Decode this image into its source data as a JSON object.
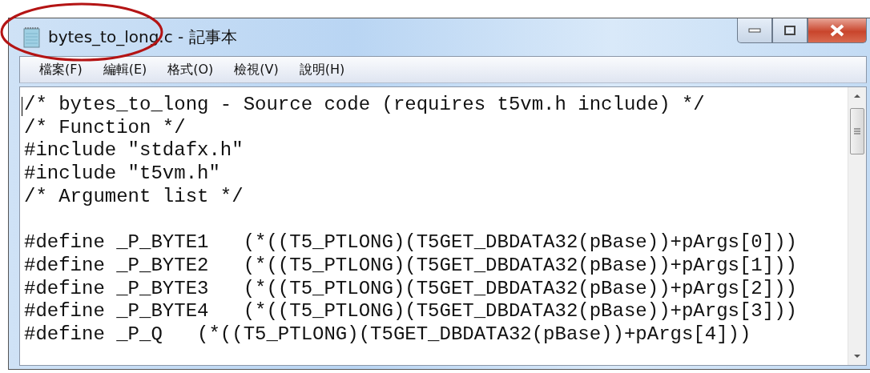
{
  "window": {
    "title": "bytes_to_long.c - 記事本"
  },
  "menu": [
    {
      "label": "檔案(F)"
    },
    {
      "label": "編輯(E)"
    },
    {
      "label": "格式(O)"
    },
    {
      "label": "檢視(V)"
    },
    {
      "label": "說明(H)"
    }
  ],
  "editor": {
    "blocks": [
      [
        "/* bytes_to_long - Source code (requires t5vm.h include) */",
        "/* Function */",
        "#include \"stdafx.h\"",
        "#include \"t5vm.h\"",
        "/* Argument list */"
      ],
      [
        "#define _P_BYTE1   (*((T5_PTLONG)(T5GET_DBDATA32(pBase))+pArgs[0]))",
        "#define _P_BYTE2   (*((T5_PTLONG)(T5GET_DBDATA32(pBase))+pArgs[1]))",
        "#define _P_BYTE3   (*((T5_PTLONG)(T5GET_DBDATA32(pBase))+pArgs[2]))",
        "#define _P_BYTE4   (*((T5_PTLONG)(T5GET_DBDATA32(pBase))+pArgs[3]))",
        "#define _P_Q   (*((T5_PTLONG)(T5GET_DBDATA32(pBase))+pArgs[4]))"
      ]
    ]
  }
}
